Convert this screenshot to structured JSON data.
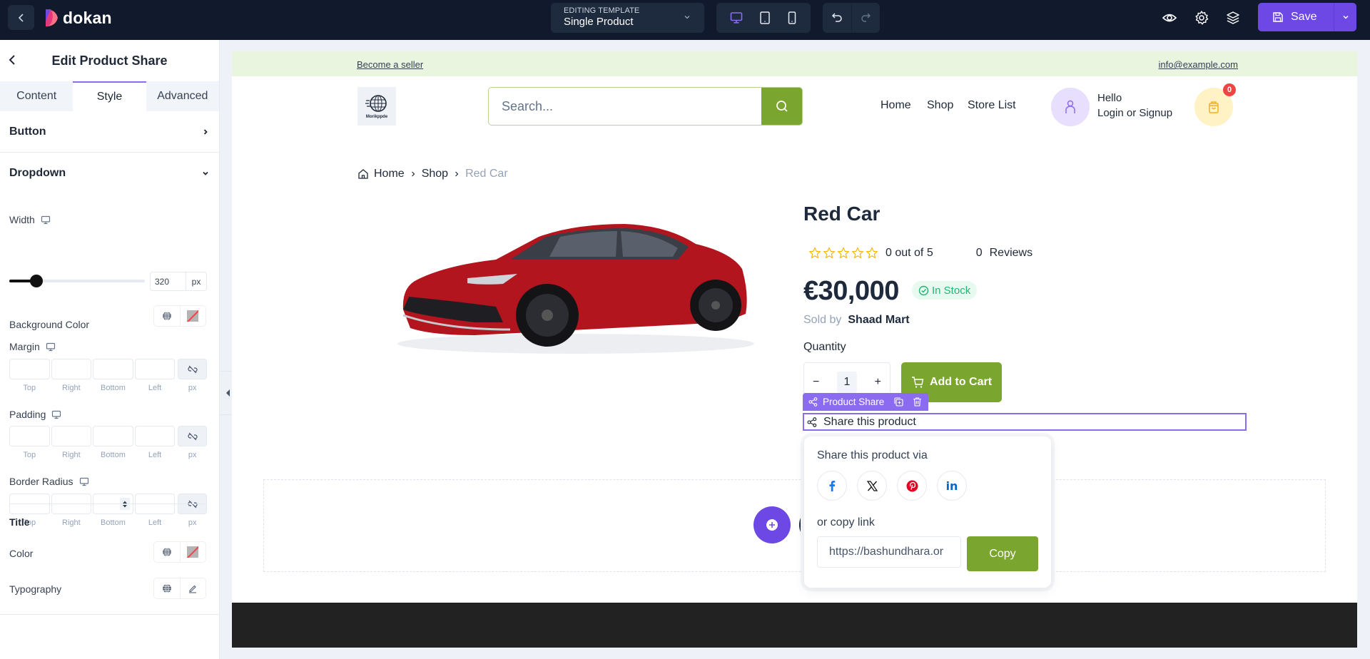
{
  "topbar": {
    "brand": "dokan",
    "template_label": "EDITING TEMPLATE",
    "template_name": "Single Product",
    "devices": [
      "desktop",
      "tablet",
      "mobile"
    ],
    "active_device": "desktop",
    "save_label": "Save",
    "accent": "#6d48e5"
  },
  "sidebar": {
    "title": "Edit Product Share",
    "tabs": [
      {
        "label": "Content"
      },
      {
        "label": "Style"
      },
      {
        "label": "Advanced"
      }
    ],
    "active_tab": "Style",
    "sections": {
      "button": "Button",
      "dropdown": "Dropdown"
    },
    "width": {
      "label": "Width",
      "value": "320",
      "unit": "px",
      "slider_fraction": 0.2
    },
    "background_color": {
      "label": "Background Color"
    },
    "margin": {
      "label": "Margin"
    },
    "padding": {
      "label": "Padding"
    },
    "border_radius": {
      "label": "Border Radius"
    },
    "side_labels": [
      "Top",
      "Right",
      "Bottom",
      "Left"
    ],
    "unit": "px",
    "title_section": {
      "heading": "Title",
      "color_label": "Color",
      "typography_label": "Typography"
    }
  },
  "page": {
    "top_left_link": "Become a seller",
    "top_right_link": "info@example.com",
    "shop_logo_text": "Morikppde",
    "search_placeholder": "Search...",
    "nav": [
      "Home",
      "Shop",
      "Store List"
    ],
    "hello": "Hello",
    "login": "Login or Signup",
    "cart_count": "0",
    "breadcrumb": [
      "Home",
      "Shop",
      "Red Car"
    ],
    "product": {
      "title": "Red Car",
      "rating_text": "0 out of 5",
      "rating_value": 0,
      "reviews_count": "0",
      "reviews_label": "Reviews",
      "price": "€30,000",
      "stock": "In Stock",
      "sold_by_label": "Sold by",
      "seller": "Shaad Mart",
      "quantity_label": "Quantity",
      "quantity": "1",
      "add_to_cart": "Add to Cart"
    },
    "widget_tag": "Product Share",
    "share_label": "Share this product",
    "popup": {
      "title": "Share this product via",
      "networks": [
        "facebook",
        "x",
        "pinterest",
        "linkedin"
      ],
      "copy_label": "or copy link",
      "link_value": "https://bashundhara.or",
      "copy_button": "Copy"
    }
  }
}
